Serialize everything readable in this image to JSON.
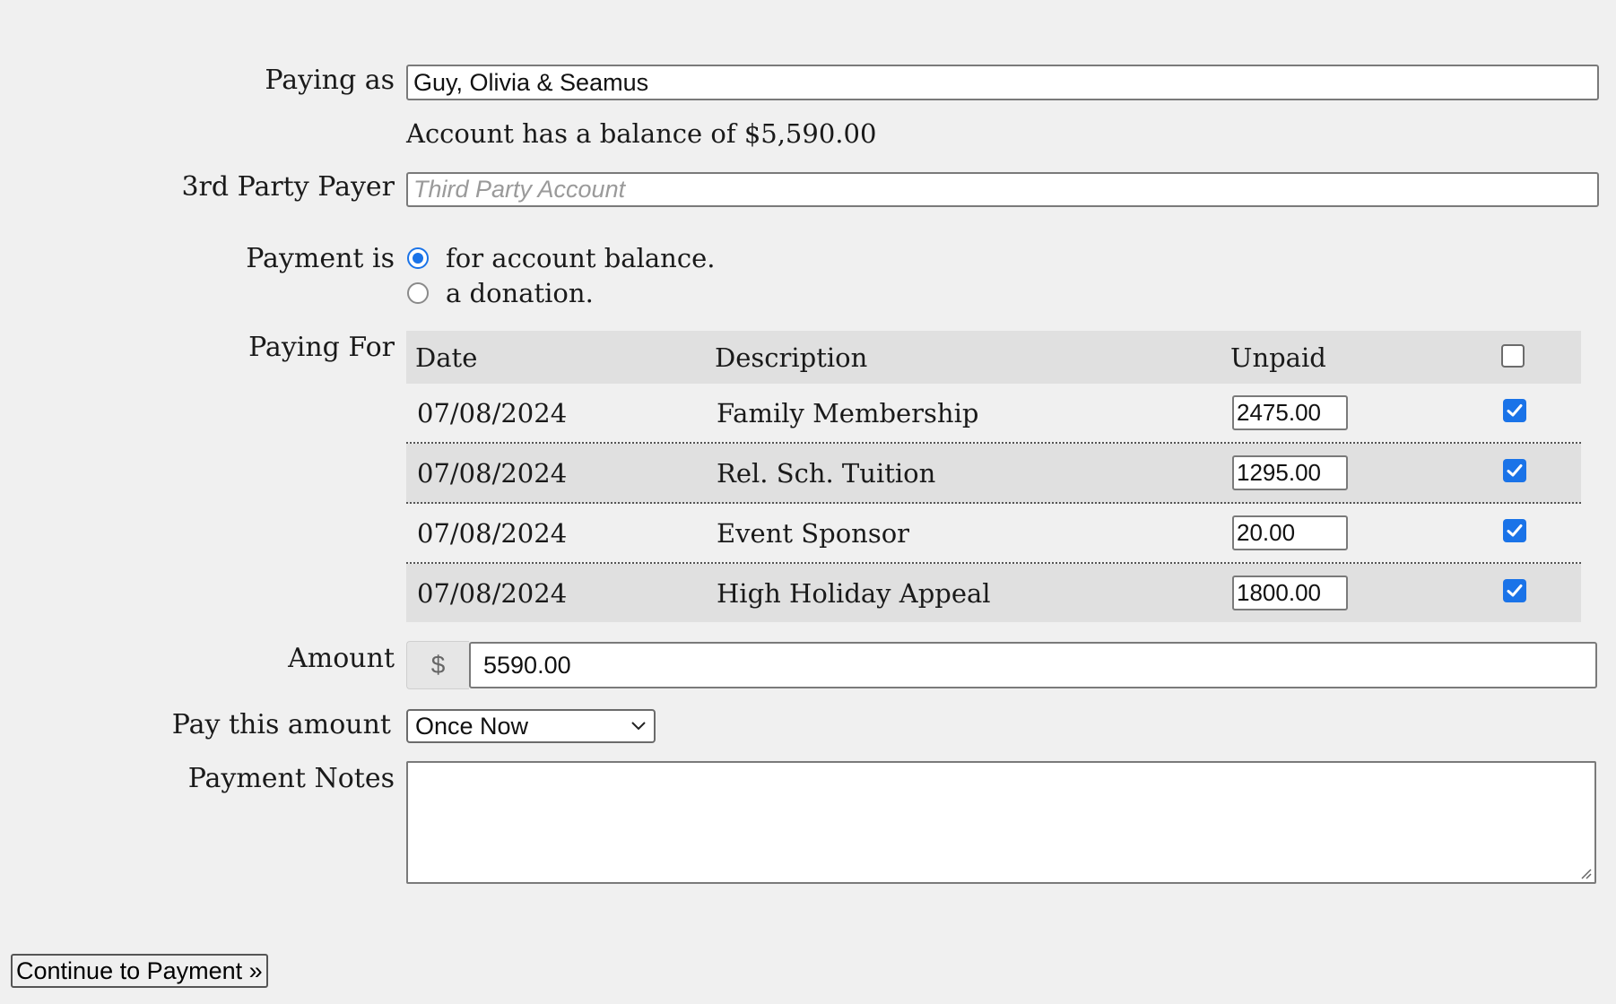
{
  "form": {
    "paying_as": {
      "label": "Paying as",
      "value": "Guy, Olivia & Seamus"
    },
    "balance_text": "Account has a balance of $5,590.00",
    "third_party": {
      "label": "3rd Party Payer",
      "placeholder": "Third Party Account"
    },
    "payment_is": {
      "label": "Payment is",
      "options": [
        {
          "label": "for account balance.",
          "selected": true
        },
        {
          "label": "a donation.",
          "selected": false
        }
      ]
    },
    "paying_for": {
      "label": "Paying For",
      "columns": [
        "Date",
        "Description",
        "Unpaid"
      ],
      "select_all_checked": false,
      "rows": [
        {
          "date": "07/08/2024",
          "description": "Family Membership",
          "unpaid": "2475.00",
          "checked": true
        },
        {
          "date": "07/08/2024",
          "description": "Rel. Sch. Tuition",
          "unpaid": "1295.00",
          "checked": true
        },
        {
          "date": "07/08/2024",
          "description": "Event Sponsor",
          "unpaid": "20.00",
          "checked": true
        },
        {
          "date": "07/08/2024",
          "description": "High Holiday Appeal",
          "unpaid": "1800.00",
          "checked": true
        }
      ]
    },
    "amount": {
      "label": "Amount",
      "currency_symbol": "$",
      "value": "5590.00"
    },
    "frequency": {
      "label": "Pay this amount",
      "selected": "Once Now"
    },
    "notes": {
      "label": "Payment Notes",
      "value": ""
    },
    "continue_label": "Continue to Payment »"
  },
  "colors": {
    "accent": "#1a73e8",
    "page_background": "#f0f0f0",
    "table_shade": "#e0e0e0"
  }
}
